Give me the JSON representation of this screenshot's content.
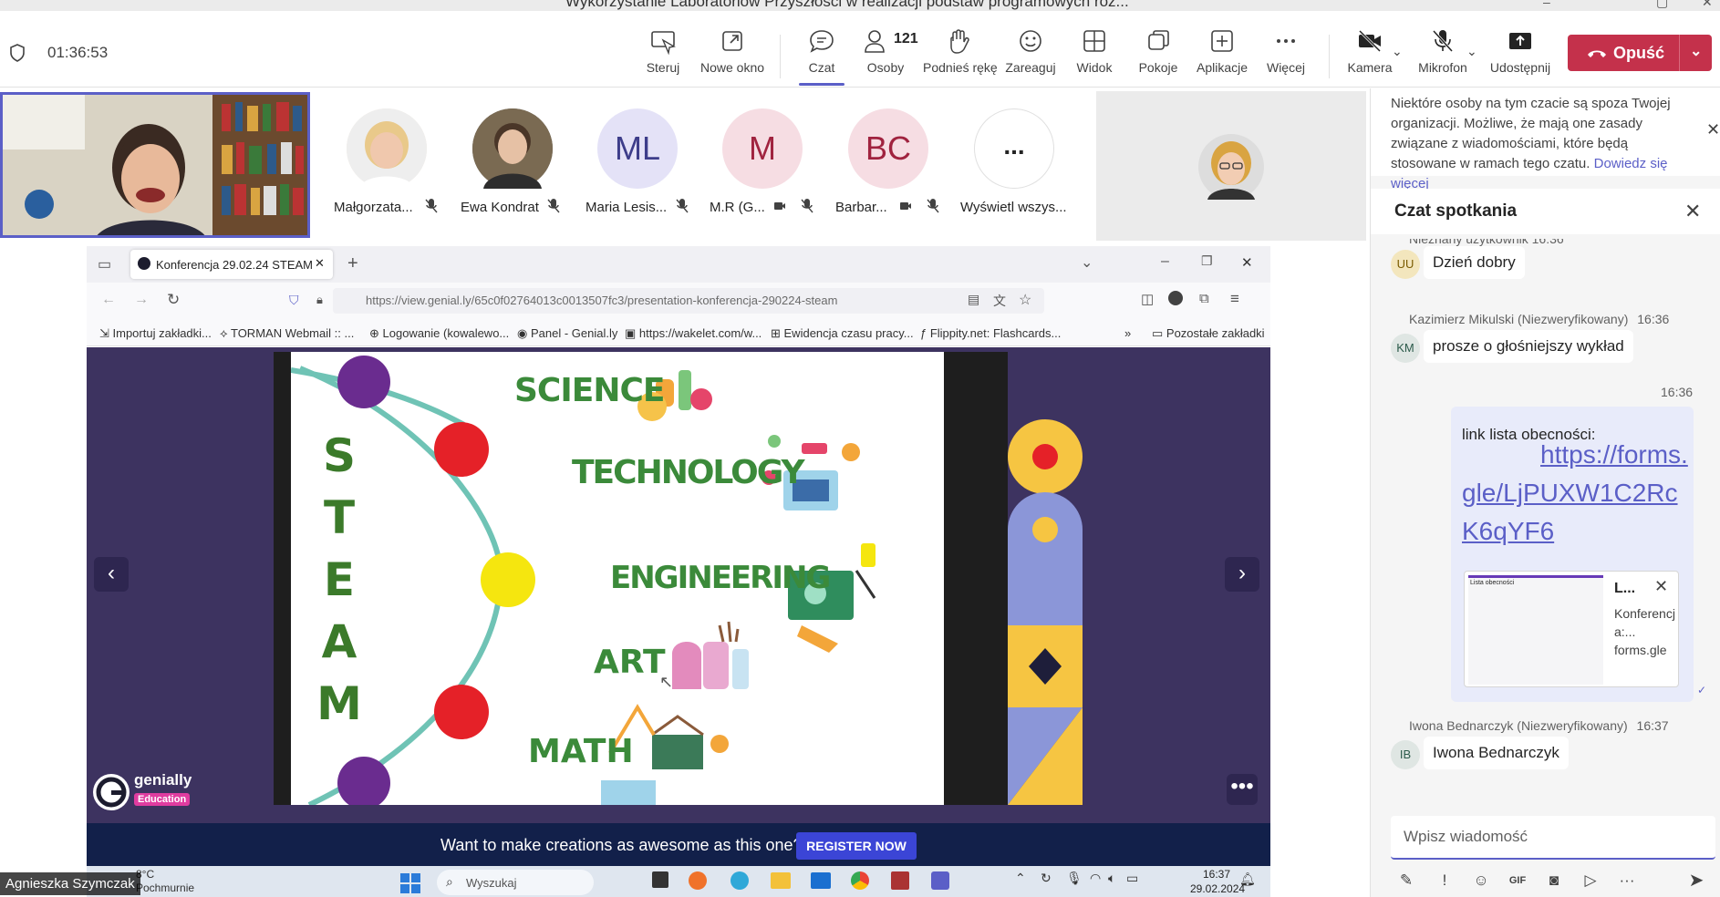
{
  "window": {
    "title": "Wykorzystanie Laboratoriów Przyszłości w realizacji podstaw programowych roz..."
  },
  "toolbar": {
    "timer": "01:36:53",
    "buttons": [
      {
        "label": "Steruj",
        "icon": "share-control-icon"
      },
      {
        "label": "Nowe okno",
        "icon": "pop-out-icon"
      },
      {
        "label": "Czat",
        "icon": "chat-icon"
      },
      {
        "label": "Osoby",
        "icon": "people-icon",
        "count": "121"
      },
      {
        "label": "Podnieś rękę",
        "icon": "raise-hand-icon"
      },
      {
        "label": "Zareaguj",
        "icon": "react-icon"
      },
      {
        "label": "Widok",
        "icon": "view-icon"
      },
      {
        "label": "Pokoje",
        "icon": "rooms-icon"
      },
      {
        "label": "Aplikacje",
        "icon": "apps-icon"
      },
      {
        "label": "Więcej",
        "icon": "more-icon"
      },
      {
        "label": "Kamera",
        "icon": "camera-off-icon"
      },
      {
        "label": "Mikrofon",
        "icon": "mic-off-icon"
      },
      {
        "label": "Udostępnij",
        "icon": "share-icon"
      }
    ],
    "leave_label": "Opuść",
    "accent": "#5b5fc7",
    "leave_color": "#c4314b"
  },
  "participants": [
    {
      "name": "Małgorzata...",
      "initials": "",
      "type": "photo"
    },
    {
      "name": "Ewa Kondrat",
      "initials": "",
      "type": "photo"
    },
    {
      "name": "Maria Lesis...",
      "initials": "ML",
      "type": "initials"
    },
    {
      "name": "M.R (G...",
      "initials": "M",
      "type": "initials"
    },
    {
      "name": "Barbar...",
      "initials": "BC",
      "type": "initials"
    },
    {
      "name": "Wyświetl wszys...",
      "initials": "...",
      "type": "more"
    }
  ],
  "shared_screen": {
    "presenter": "Agnieszka Szymczak",
    "browser": {
      "tab_title": "Konferencja 29.02.24 STEAM",
      "url": "https://view.genial.ly/65c0f02764013c0013507fc3/presentation-konferencja-290224-steam",
      "bookmarks": [
        "Importuj zakładki...",
        "TORMAN Webmail :: ...",
        "Logowanie (kowalewo...",
        "Panel - Genial.ly",
        "https://wakelet.com/w...",
        "Ewidencja czasu pracy...",
        "Flippity.net: Flashcards...",
        "Pozostałe zakładki"
      ]
    },
    "slide": {
      "acronym": [
        "S",
        "T",
        "E",
        "A",
        "M"
      ],
      "subjects": [
        "SCIENCE",
        "TECHNOLOGY",
        "ENGINEERING",
        "ART",
        "MATH"
      ],
      "logo_text": "genially",
      "logo_badge": "Education"
    },
    "promo_text": "Want to make creations as awesome as this one?",
    "register_label": "REGISTER NOW",
    "taskbar": {
      "weather_temp": "8°C",
      "weather_desc": "Pochmurnie",
      "search": "Wyszukaj",
      "time": "16:37",
      "date": "29.02.2024"
    }
  },
  "chat": {
    "notice": "Niektóre osoby na tym czacie są spoza Twojej organizacji. Możliwe, że mają one zasady związane z wiadomościami, które będą stosowane w ramach tego czatu.",
    "notice_link": "Dowiedz się więcej",
    "title": "Czat spotkania",
    "messages": [
      {
        "author": "Nieznany użytkownik",
        "time": "16:36",
        "initials": "UU",
        "text": "Dzień dobry"
      },
      {
        "author": "Kazimierz Mikulski (Niezweryfikowany)",
        "time": "16:36",
        "initials": "KM",
        "text": "prosze o głośniejszy wykład"
      },
      {
        "author": "",
        "time": "16:36",
        "initials": "",
        "text": "link lista obecności:",
        "link": "https://forms.gle/LjPUXW1C2RcK6qYF6",
        "preview_title": "L...",
        "preview_desc": "Konferencja:...",
        "preview_domain": "forms.gle",
        "preview_form_title": "Lista obecności"
      },
      {
        "author": "Iwona Bednarczyk (Niezweryfikowany)",
        "time": "16:37",
        "initials": "IB",
        "text": "Iwona Bednarczyk"
      }
    ],
    "composer_placeholder": "Wpisz wiadomość"
  }
}
